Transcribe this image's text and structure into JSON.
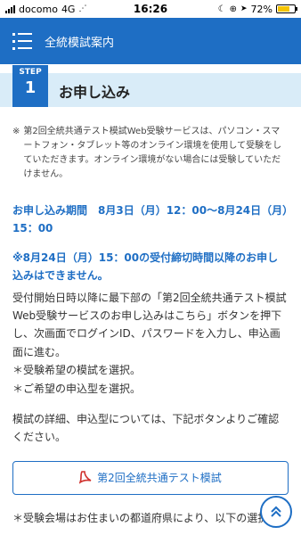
{
  "status_bar": {
    "carrier": "docomo",
    "network": "4G",
    "time": "16:26",
    "battery_text": "72%",
    "battery_level": 0.72
  },
  "header": {
    "title": "全統模試案内"
  },
  "step": {
    "label": "STEP",
    "number": "1",
    "title": "お申し込み"
  },
  "note": {
    "mark": "※",
    "text": "第2回全統共通テスト模試Web受験サービスは、パソコン・スマートフォン・タブレット等のオンライン環境を使用して受験をしていただきます。オンライン環境がない場合には受験していただけません。"
  },
  "period": {
    "text": "お申し込み期間　8月3日（月）12：00〜8月24日（月）15：00"
  },
  "warning": {
    "text": "※8月24日（月）15：00の受付締切時間以降のお申し込みはできません。"
  },
  "instructions": {
    "main": "受付開始日時以降に最下部の「第2回全統共通テスト模試Web受験サービスのお申し込みはこちら」ボタンを押下し、次画面でログインID、パスワードを入力し、申込画面に進む。",
    "line1": "＊受験希望の模試を選択。",
    "line2": "＊ご希望の申込型を選択。"
  },
  "details": {
    "text": "模試の詳細、申込型については、下記ボタンよりご確認ください。"
  },
  "pdf_button": {
    "label": "第2回全統共通テスト模試"
  },
  "venue": {
    "text": "＊受験会場はお住まいの都道府県により、以下の選択。"
  },
  "colors": {
    "primary": "#1e6ec4",
    "step_bar": "#d9ecf8",
    "pdf_red": "#d0312d"
  },
  "icons": {
    "menu": "hamburger-menu-icon",
    "pdf": "pdf-file-icon",
    "scroll_top": "double-chevron-up-icon"
  }
}
